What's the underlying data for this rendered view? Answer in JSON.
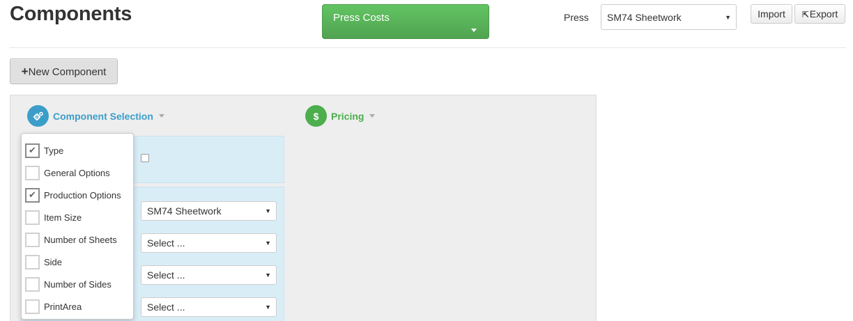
{
  "page": {
    "title": "Components"
  },
  "press_costs": {
    "label": "Press Costs"
  },
  "press": {
    "label": "Press",
    "selected": "SM74 Sheetwork"
  },
  "toolbar": {
    "import_label": "Import",
    "export_label": "Export"
  },
  "new_component": {
    "label": "New Component"
  },
  "sections": {
    "component_selection": {
      "title": "Component Selection",
      "icon": "cogs-icon"
    },
    "pricing": {
      "title": "Pricing",
      "icon": "dollar-icon"
    }
  },
  "form": {
    "selects": [
      "SM74 Sheetwork",
      "Select ...",
      "Select ...",
      "Select ..."
    ]
  },
  "dropdown": {
    "items": [
      {
        "label": "Type",
        "checked": true
      },
      {
        "label": "General Options",
        "checked": false
      },
      {
        "label": "Production Options",
        "checked": true
      },
      {
        "label": "Item Size",
        "checked": false
      },
      {
        "label": "Number of Sheets",
        "checked": false
      },
      {
        "label": "Side",
        "checked": false
      },
      {
        "label": "Number of Sides",
        "checked": false
      },
      {
        "label": "PrintArea",
        "checked": false
      }
    ]
  },
  "colors": {
    "success": "#5cb85c",
    "info": "#3b9ec9",
    "panel_bg": "#eeeeee",
    "highlight_bg": "#d9edf7"
  }
}
